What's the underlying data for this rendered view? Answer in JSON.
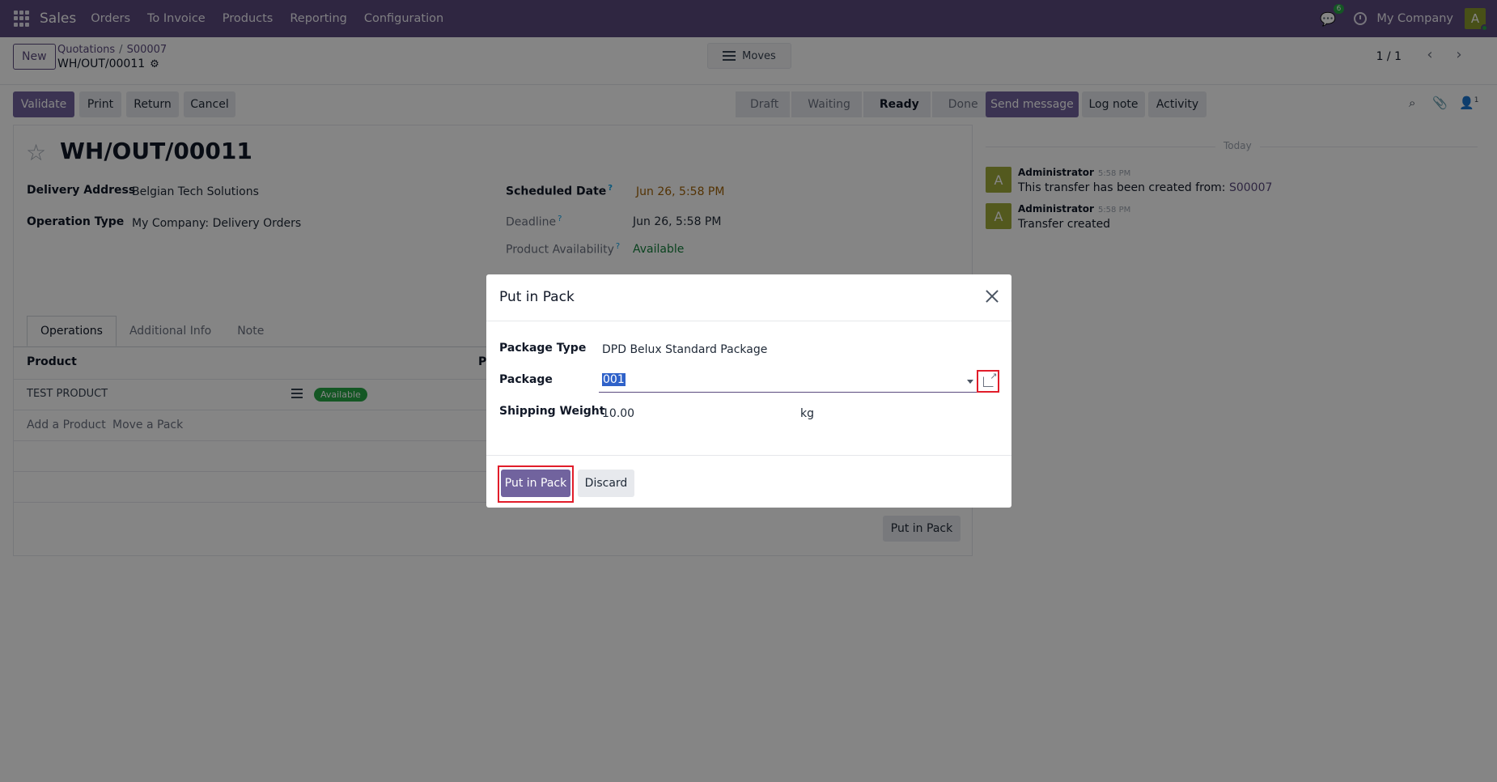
{
  "navbar": {
    "app_name": "Sales",
    "menu": [
      "Orders",
      "To Invoice",
      "Products",
      "Reporting",
      "Configuration"
    ],
    "chat_count": "6",
    "company": "My Company",
    "avatar_letter": "A"
  },
  "control": {
    "new_label": "New",
    "breadcrumb": [
      "Quotations",
      "S00007"
    ],
    "record_name": "WH/OUT/00011",
    "moves_label": "Moves",
    "pager": "1 / 1"
  },
  "actions": {
    "validate": "Validate",
    "print": "Print",
    "return": "Return",
    "cancel": "Cancel"
  },
  "statusbar": {
    "stages": [
      "Draft",
      "Waiting",
      "Ready",
      "Done"
    ],
    "active": "Ready"
  },
  "form": {
    "title": "WH/OUT/00011",
    "delivery_address_label": "Delivery Address",
    "delivery_address": "Belgian Tech Solutions",
    "operation_type_label": "Operation Type",
    "operation_type": "My Company: Delivery Orders",
    "scheduled_date_label": "Scheduled Date",
    "scheduled_date": "Jun 26, 5:58 PM",
    "deadline_label": "Deadline",
    "deadline": "Jun 26, 5:58 PM",
    "availability_label": "Product Availability",
    "availability": "Available",
    "help_mark": "?",
    "tabs": [
      "Operations",
      "Additional Info",
      "Note"
    ],
    "col_product": "Product",
    "col_p": "P",
    "row_product": "TEST PRODUCT",
    "row_status": "Available",
    "add_product": "Add a Product",
    "move_pack": "Move a Pack",
    "put_in_pack": "Put in Pack"
  },
  "chatter": {
    "send_message": "Send message",
    "log_note": "Log note",
    "activity": "Activity",
    "followers": "1",
    "today": "Today",
    "messages": [
      {
        "avatar": "A",
        "author": "Administrator",
        "time": "5:58 PM",
        "body": "This transfer has been created from: ",
        "ref": "S00007"
      },
      {
        "avatar": "A",
        "author": "Administrator",
        "time": "5:58 PM",
        "body": "Transfer created",
        "ref": ""
      }
    ]
  },
  "modal": {
    "title": "Put in Pack",
    "package_type_label": "Package Type",
    "package_type": "DPD Belux Standard Package",
    "package_label": "Package",
    "package_value": "001",
    "weight_label": "Shipping Weight",
    "weight_value": "10.00",
    "weight_unit": "kg",
    "confirm": "Put in Pack",
    "discard": "Discard"
  },
  "colors": {
    "navbar": "#5a4a7e",
    "primary": "#71639e",
    "success": "#28a745",
    "highlight": "#e11d2a"
  }
}
